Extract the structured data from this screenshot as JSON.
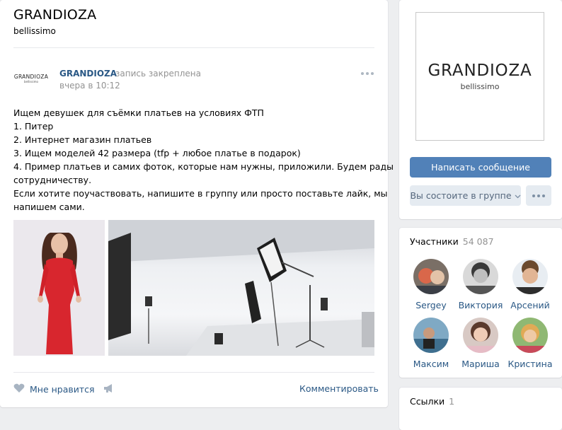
{
  "group": {
    "name": "GRANDIOZA",
    "status": "bellissimo"
  },
  "post": {
    "avatar_main": "GRANDIOZA",
    "avatar_sub": "bellissimo",
    "author": "GRANDIOZA",
    "pinned_label": "запись закреплена",
    "time": "вчера в 10:12",
    "text_lines": [
      "Ищем девушек для съёмки платьев на условиях ФТП",
      "1. Питер",
      "2. Интернет магазин платьев",
      "3. Ищем моделей 42 размера (tfp + любое платье в подарок)",
      "4. Пример платьев и самих фоток, которые нам нужны, приложили. Будем рады",
      "сотрудничеству.",
      "Если хотите поучаствовать, напишите в группу или просто поставьте лайк, мы",
      "напишем сами."
    ],
    "like_label": "Мне нравится",
    "comment_label": "Комментировать"
  },
  "cover": {
    "logo_main": "GRANDIOZA",
    "logo_sub": "bellissimo"
  },
  "actions": {
    "message_button": "Написать сообщение",
    "member_button": "Вы состоите в группе"
  },
  "members": {
    "title": "Участники",
    "count": "54 087",
    "items": [
      {
        "name": "Sergey"
      },
      {
        "name": "Виктория"
      },
      {
        "name": "Арсений"
      },
      {
        "name": "Максим"
      },
      {
        "name": "Мариша"
      },
      {
        "name": "Кристина"
      }
    ]
  },
  "links": {
    "title": "Ссылки",
    "count": "1"
  },
  "colors": {
    "link": "#2a5885",
    "button": "#5181b8",
    "secondary_button": "#e5ebf1",
    "muted": "#939393",
    "page_bg": "#edeef0"
  },
  "icons": {
    "like": "heart-icon",
    "share": "megaphone-icon",
    "more": "more-dots-icon",
    "dropdown": "chevron-down-icon"
  }
}
